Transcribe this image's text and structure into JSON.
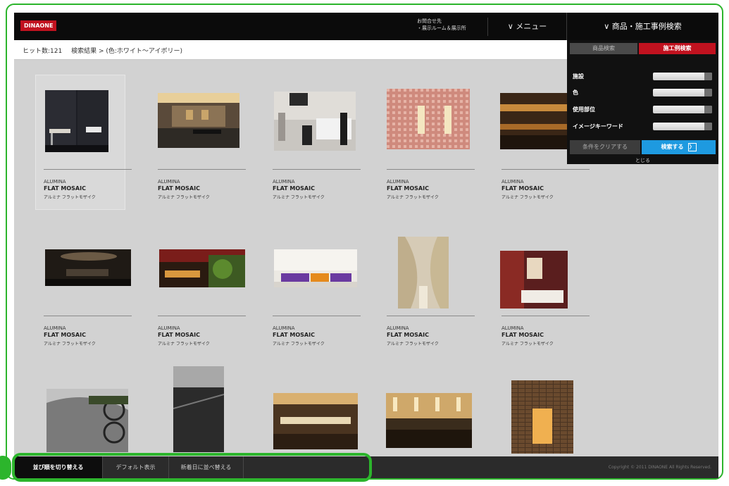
{
  "header": {
    "logo": "DINAONE",
    "showroom_text": "お問合せ先\n・展示ルーム＆展示所",
    "menu_label": "∨ メニュー",
    "search_label": "∨ 商品・施工事例検索"
  },
  "breadcrumb": {
    "hits": "ヒット数:121",
    "path": "検索結果 > (色:ホワイト〜アイボリー)"
  },
  "search_panel": {
    "tab_product": "商品検索",
    "tab_case": "施工例検索",
    "fields": [
      {
        "label": "施設"
      },
      {
        "label": "色"
      },
      {
        "label": "使用部位"
      },
      {
        "label": "イメージキーワード"
      }
    ],
    "clear_label": "条件をクリアする",
    "go_label": "検索する",
    "go_arrow": "〉",
    "close_label": "とじる"
  },
  "products": [
    {
      "l1": "ALUMINA",
      "l2": "FLAT MOSAIC",
      "l3": "アルミナ フラットモザイク"
    },
    {
      "l1": "ALUMINA",
      "l2": "FLAT MOSAIC",
      "l3": "アルミナ フラットモザイク"
    },
    {
      "l1": "ALUMINA",
      "l2": "FLAT MOSAIC",
      "l3": "アルミナ フラットモザイク"
    },
    {
      "l1": "ALUMINA",
      "l2": "FLAT MOSAIC",
      "l3": "アルミナ フラットモザイク"
    },
    {
      "l1": "ALUMINA",
      "l2": "FLAT MOSAIC",
      "l3": "アルミナ フラットモザイク"
    },
    {
      "l1": "ALUMINA",
      "l2": "FLAT MOSAIC",
      "l3": "アルミナ フラットモザイク"
    },
    {
      "l1": "ALUMINA",
      "l2": "FLAT MOSAIC",
      "l3": "アルミナ フラットモザイク"
    },
    {
      "l1": "ALUMINA",
      "l2": "FLAT MOSAIC",
      "l3": "アルミナ フラットモザイク"
    },
    {
      "l1": "ALUMINA",
      "l2": "FLAT MOSAIC",
      "l3": "アルミナ フラットモザイク"
    },
    {
      "l1": "ALUMINA",
      "l2": "FLAT MOSAIC",
      "l3": "アルミナ フラットモザイク"
    }
  ],
  "bottombar": {
    "switch_order": "並び順を切り替える",
    "default_order": "デフォルト表示",
    "newest_order": "新着日に並べ替える",
    "copyright": "Copyright © 2011 DINAONE All Rights Reserved."
  },
  "colors": {
    "brand_red": "#c1121f",
    "search_blue": "#1e9ae0",
    "annotation_green": "#2cb52c"
  }
}
